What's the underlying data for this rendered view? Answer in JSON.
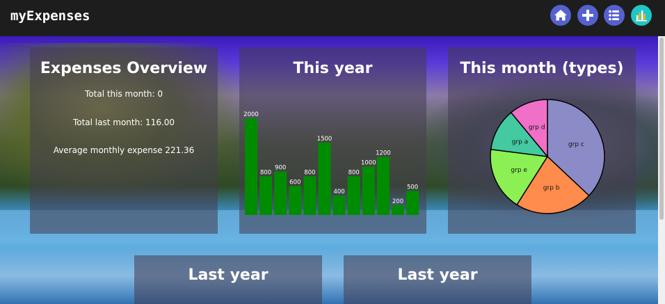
{
  "app": {
    "title": "myExpenses"
  },
  "nav": [
    {
      "name": "home-button",
      "icon": "home-icon",
      "color": "#5561cf"
    },
    {
      "name": "add-button",
      "icon": "plus-icon",
      "color": "#5561cf"
    },
    {
      "name": "list-button",
      "icon": "list-icon",
      "color": "#5561cf"
    },
    {
      "name": "stats-button",
      "icon": "bar-chart-icon",
      "color": "#1fc6c8"
    }
  ],
  "overview": {
    "title": "Expenses Overview",
    "total_this_month": "Total this month: 0",
    "total_last_month": "Total last month: 116.00",
    "average": "Average monthly expense 221.36"
  },
  "this_year": {
    "title": "This year"
  },
  "this_month": {
    "title": "This month (types)"
  },
  "last_year_1": {
    "title": "Last year"
  },
  "last_year_2": {
    "title": "Last year"
  },
  "chart_data": [
    {
      "type": "bar",
      "values": [
        2000,
        800,
        900,
        600,
        800,
        1500,
        400,
        800,
        1000,
        1200,
        200,
        500
      ],
      "labels": [
        "2000",
        "800",
        "900",
        "600",
        "800",
        "1500",
        "400",
        "800",
        "1000",
        "1200",
        "200",
        "500"
      ],
      "color": "#008c00",
      "ylim": [
        0,
        2000
      ]
    },
    {
      "type": "pie",
      "slices": [
        {
          "label": "grp c",
          "value": 37,
          "color": "#8b8bc8"
        },
        {
          "label": "grp b",
          "value": 22,
          "color": "#ff8c4c"
        },
        {
          "label": "grp e",
          "value": 18,
          "color": "#8cf055"
        },
        {
          "label": "grp a",
          "value": 12,
          "color": "#44c9a0"
        },
        {
          "label": "grp d",
          "value": 11,
          "color": "#f070c8"
        }
      ]
    }
  ]
}
